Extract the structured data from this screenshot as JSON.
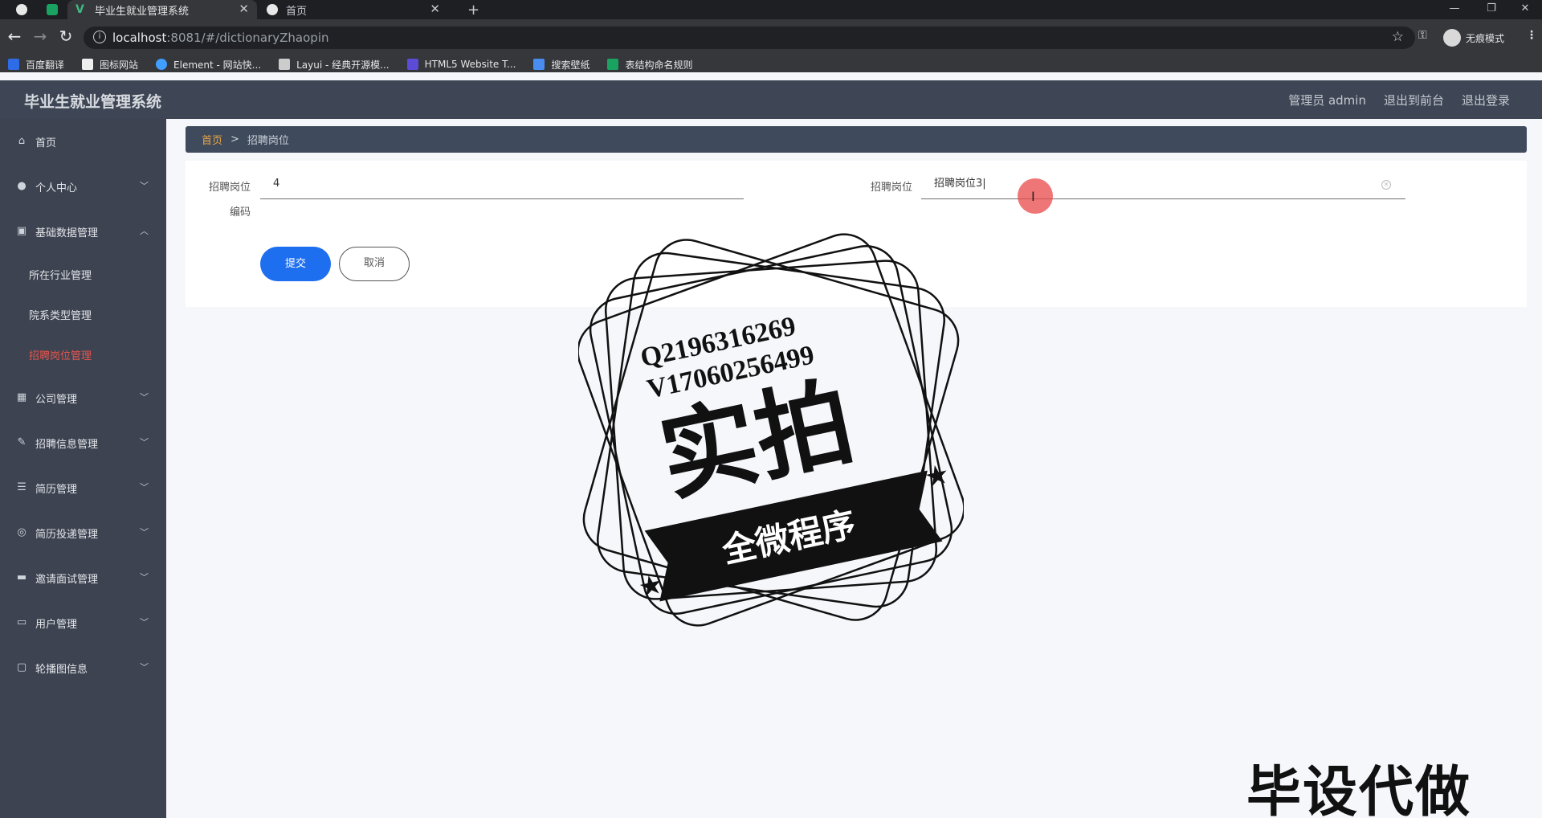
{
  "browser": {
    "tabs": [
      {
        "label": "毕业生就业管理系统",
        "active": true
      },
      {
        "label": "首页",
        "active": false
      }
    ],
    "url_host": "localhost",
    "url_rest": ":8081/#/dictionaryZhaopin",
    "incognito_label": "无痕模式",
    "bookmarks": [
      "百度翻译",
      "图标网站",
      "Element - 网站快...",
      "Layui - 经典开源模...",
      "HTML5 Website T...",
      "搜索壁纸",
      "表结构命名规则"
    ]
  },
  "header": {
    "title": "毕业生就业管理系统",
    "user": "管理员 admin",
    "to_front": "退出到前台",
    "logout": "退出登录"
  },
  "sidebar": {
    "items": [
      {
        "label": "首页",
        "icon": "home-icon"
      },
      {
        "label": "个人中心",
        "icon": "user-icon"
      },
      {
        "label": "基础数据管理",
        "icon": "clipboard-icon"
      },
      {
        "label": "公司管理",
        "icon": "grid-icon"
      },
      {
        "label": "招聘信息管理",
        "icon": "pen-icon"
      },
      {
        "label": "简历管理",
        "icon": "list-icon"
      },
      {
        "label": "简历投递管理",
        "icon": "globe-icon"
      },
      {
        "label": "邀请面试管理",
        "icon": "message-icon"
      },
      {
        "label": "用户管理",
        "icon": "monitor-icon"
      },
      {
        "label": "轮播图信息",
        "icon": "chat-icon"
      }
    ],
    "sub_items": [
      "所在行业管理",
      "院系类型管理",
      "招聘岗位管理"
    ],
    "active_sub": "招聘岗位管理"
  },
  "breadcrumb": {
    "home": "首页",
    "separator": ">",
    "current": "招聘岗位"
  },
  "form": {
    "field1_label_line1": "招聘岗位",
    "field1_label_line2": "编码",
    "field1_value": "4",
    "field2_label": "招聘岗位",
    "field2_value": "招聘岗位3",
    "submit": "提交",
    "cancel": "取消"
  },
  "watermark": {
    "qq": "Q2196316269",
    "vx": "V17060256499",
    "main": "实拍",
    "ribbon": "全微程序",
    "corner": "毕设代做"
  },
  "colors": {
    "accent": "#1e6ef0",
    "active_menu": "#e8564d",
    "sidebar_bg": "#3d4351",
    "breadcrumb_home": "#e9a546"
  }
}
